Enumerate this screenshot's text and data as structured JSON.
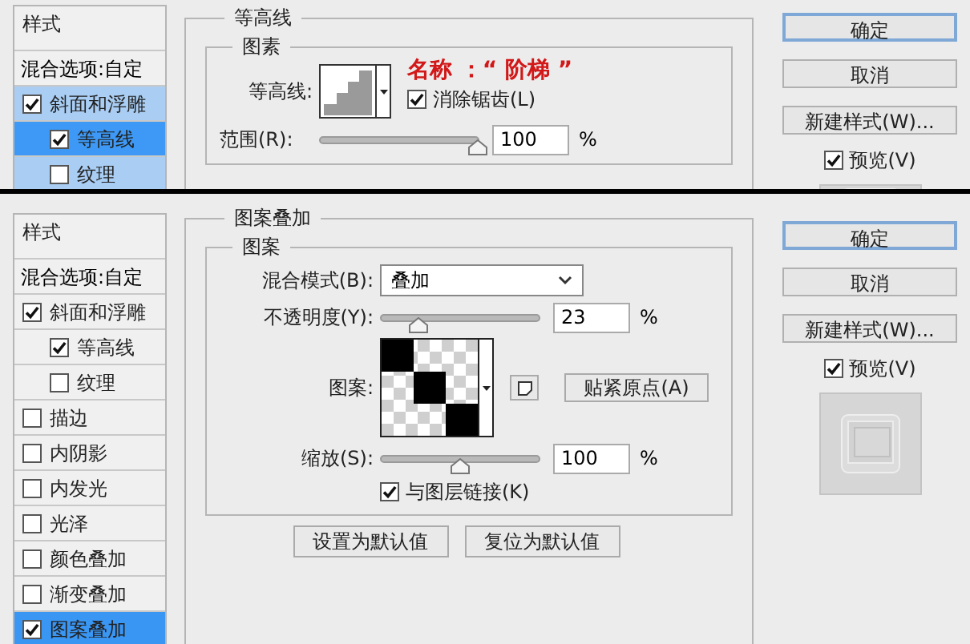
{
  "panels": [
    {
      "sidebar": {
        "header": "样式",
        "blend_options": "混合选项:自定",
        "items": [
          {
            "label": "斜面和浮雕",
            "checked": true,
            "selected": false,
            "highlighted": true,
            "children": [
              {
                "label": "等高线",
                "checked": true,
                "selected": true,
                "highlighted": true
              },
              {
                "label": "纹理",
                "checked": false,
                "selected": false,
                "highlighted": true
              }
            ]
          }
        ]
      },
      "section": {
        "title": "等高线",
        "group": {
          "title": "图素",
          "rows": [
            {
              "kind": "contour",
              "label": "等高线:",
              "checkbox": {
                "label": "消除锯齿(L)",
                "checked": true
              },
              "annotation": "名称 ：“ 阶梯 ”"
            },
            {
              "kind": "slider",
              "label": "范围(R):",
              "level": 1,
              "value": "100",
              "unit": "%"
            }
          ]
        }
      },
      "buttons": [
        {
          "label": "确定",
          "default": true
        },
        {
          "label": "取消",
          "default": false
        },
        {
          "label": "新建样式(W)...",
          "default": false
        }
      ],
      "preview": {
        "label": "预览(V)",
        "checked": true
      }
    },
    {
      "sidebar": {
        "header": "样式",
        "blend_options": "混合选项:自定",
        "items": [
          {
            "label": "斜面和浮雕",
            "checked": true,
            "selected": false,
            "highlighted": false,
            "children": [
              {
                "label": "等高线",
                "checked": true,
                "selected": false,
                "highlighted": false
              },
              {
                "label": "纹理",
                "checked": false,
                "selected": false,
                "highlighted": false
              }
            ]
          },
          {
            "label": "描边",
            "checked": false,
            "selected": false,
            "highlighted": false
          },
          {
            "label": "内阴影",
            "checked": false,
            "selected": false,
            "highlighted": false
          },
          {
            "label": "内发光",
            "checked": false,
            "selected": false,
            "highlighted": false
          },
          {
            "label": "光泽",
            "checked": false,
            "selected": false,
            "highlighted": false
          },
          {
            "label": "颜色叠加",
            "checked": false,
            "selected": false,
            "highlighted": false
          },
          {
            "label": "渐变叠加",
            "checked": false,
            "selected": false,
            "highlighted": false
          },
          {
            "label": "图案叠加",
            "checked": true,
            "selected": true,
            "highlighted": false
          }
        ]
      },
      "section": {
        "title": "图案叠加",
        "group": {
          "title": "图案",
          "rows": [
            {
              "kind": "select",
              "label": "混合模式(B):",
              "value": "叠加"
            },
            {
              "kind": "slider",
              "label": "不透明度(Y):",
              "level": 0.23,
              "value": "23",
              "unit": "%"
            },
            {
              "kind": "pattern",
              "label": "图案:",
              "snap_button": "贴紧原点(A)"
            },
            {
              "kind": "slider",
              "label": "缩放(S):",
              "level": 0.5,
              "value": "100",
              "unit": "%"
            },
            {
              "kind": "checkbox",
              "label": "与图层链接(K)",
              "checked": true
            }
          ]
        },
        "footer_buttons": [
          "设置为默认值",
          "复位为默认值"
        ]
      },
      "buttons": [
        {
          "label": "确定",
          "default": true
        },
        {
          "label": "取消",
          "default": false
        },
        {
          "label": "新建样式(W)...",
          "default": false
        }
      ],
      "preview": {
        "label": "预览(V)",
        "checked": true
      }
    }
  ]
}
